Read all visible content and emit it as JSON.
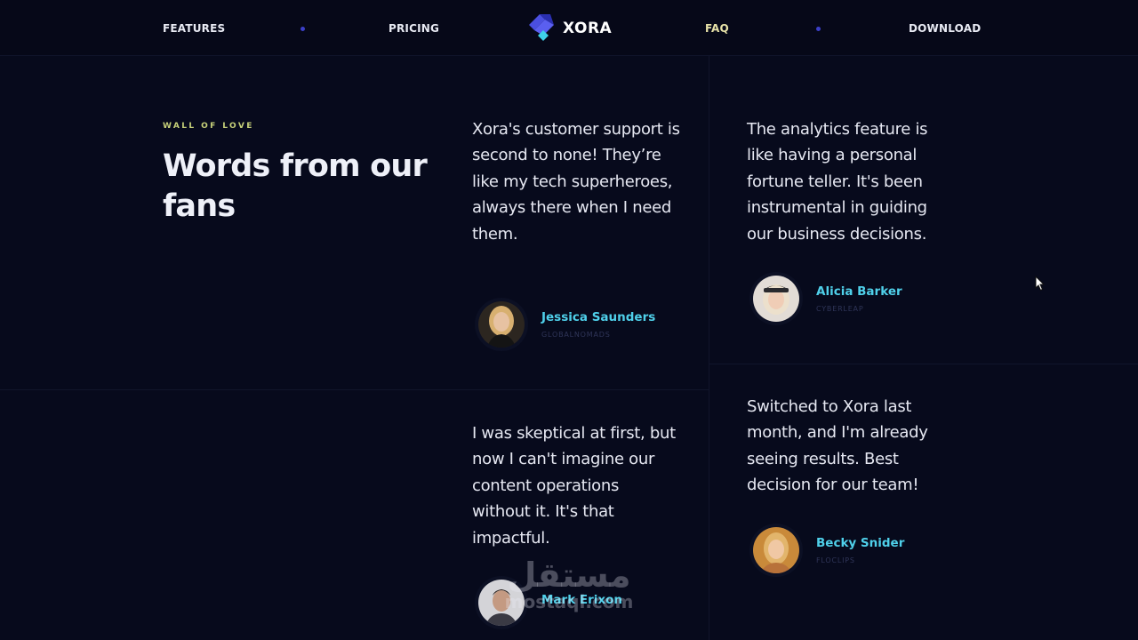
{
  "nav": {
    "items": [
      {
        "label": "FEATURES"
      },
      {
        "label": "PRICING"
      },
      {
        "label": "FAQ",
        "active": true
      },
      {
        "label": "DOWNLOAD"
      }
    ],
    "logo_text": "XORA"
  },
  "section": {
    "eyebrow": "WALL OF LOVE",
    "title": "Words from our fans"
  },
  "testimonials": [
    {
      "quote": "Xora's customer support is second to none! They’re like my tech superheroes, always there when I need them.",
      "name": "Jessica Saunders",
      "company": "GLOBALNOMADS"
    },
    {
      "quote": "I was skeptical at first, but now I can't imagine our content operations without it. It's that impactful.",
      "name": "Mark Erixon",
      "company": ""
    },
    {
      "quote": "The analytics feature is like having a personal fortune teller. It's been instrumental in guiding our business decisions.",
      "name": "Alicia Barker",
      "company": "CYBERLEAP"
    },
    {
      "quote": "Switched to Xora last month, and I'm already seeing results. Best decision for our team!",
      "name": "Becky Snider",
      "company": "FLOCLIPS"
    }
  ],
  "watermark": {
    "arabic": "مستقل",
    "latin": "mostaql.com"
  },
  "colors": {
    "background": "#070a1c",
    "accent_name": "#4fd0ea",
    "eyebrow": "#c8d27a",
    "nav_active": "#e7e2a8",
    "nav_dot": "#3b3fc7"
  }
}
